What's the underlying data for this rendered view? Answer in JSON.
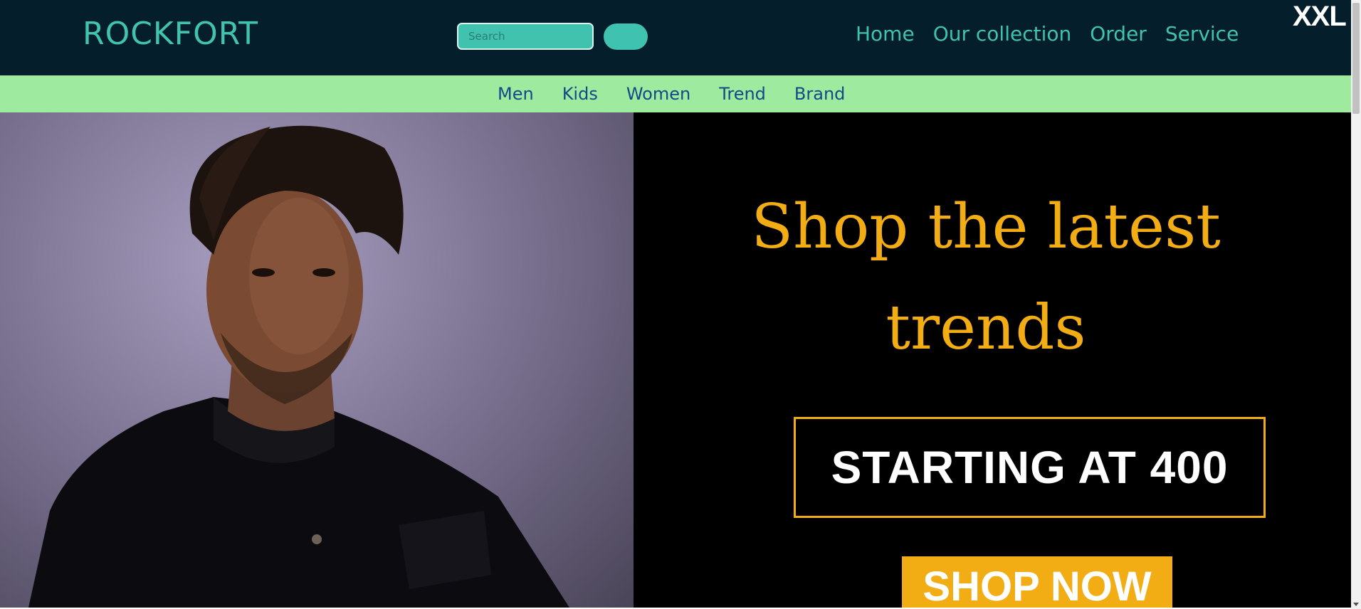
{
  "header": {
    "brand": "ROCKFORT",
    "search": {
      "placeholder": "Search",
      "value": "",
      "button_label": ""
    },
    "nav": [
      "Home",
      "Our collection",
      "Order",
      "Service"
    ],
    "badge": "XXL"
  },
  "categories": [
    "Men",
    "Kids",
    "Women",
    "Trend",
    "Brand"
  ],
  "hero": {
    "photo_icon": "model-photo",
    "headline_line1": "Shop the latest",
    "headline_line2": "trends",
    "price_text": "STARTING AT 400",
    "cta_label": "SHOP NOW"
  },
  "colors": {
    "header_bg": "#041e2b",
    "accent_teal": "#3fc2b0",
    "category_bg": "#9eeba0",
    "category_text": "#124a86",
    "promo_gold": "#f2ac14",
    "promo_bg": "#000000"
  }
}
